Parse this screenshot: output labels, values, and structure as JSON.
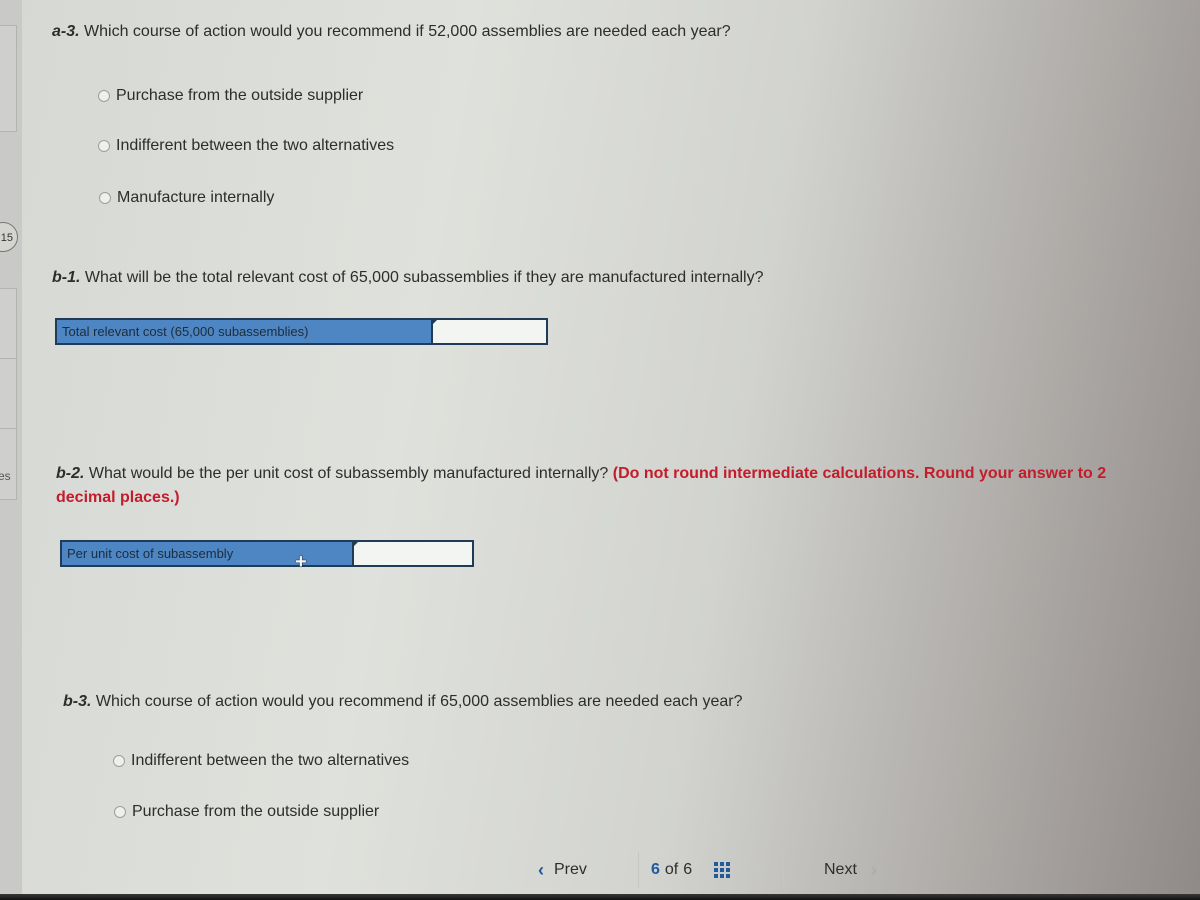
{
  "sidebar": {
    "badge_text": "15",
    "partial_label": "es"
  },
  "questions": {
    "a3": {
      "number": "a-3.",
      "text": "Which course of action would you recommend if 52,000 assemblies are needed each year?",
      "options": [
        {
          "label": "Purchase from the outside supplier",
          "selected": false
        },
        {
          "label": "Indifferent between the two alternatives",
          "selected": false
        },
        {
          "label": "Manufacture internally",
          "selected": false
        }
      ]
    },
    "b1": {
      "number": "b-1.",
      "text": "What will be the total relevant cost of 65,000 subassemblies if they are manufactured internally?",
      "answer_label": "Total relevant cost (65,000 subassemblies)",
      "answer_value": ""
    },
    "b2": {
      "number": "b-2.",
      "text": "What would be the per unit cost of subassembly manufactured internally?",
      "instruction": "(Do not round intermediate calculations. Round your answer to 2 decimal places.)",
      "answer_label": "Per unit cost of subassembly",
      "answer_value": ""
    },
    "b3": {
      "number": "b-3.",
      "text": "Which course of action would you recommend if 65,000 assemblies are needed each year?",
      "options": [
        {
          "label": "Indifferent between the two alternatives",
          "selected": false
        },
        {
          "label": "Purchase from the outside supplier",
          "selected": false
        }
      ]
    }
  },
  "footer": {
    "prev_label": "Prev",
    "current_page": "6",
    "of_label": "of",
    "total_pages": "6",
    "next_label": "Next"
  },
  "colors": {
    "label_cell_blue": "#4d86c2",
    "instruction_red": "#c31c2b",
    "nav_blue": "#1f5a9c"
  }
}
